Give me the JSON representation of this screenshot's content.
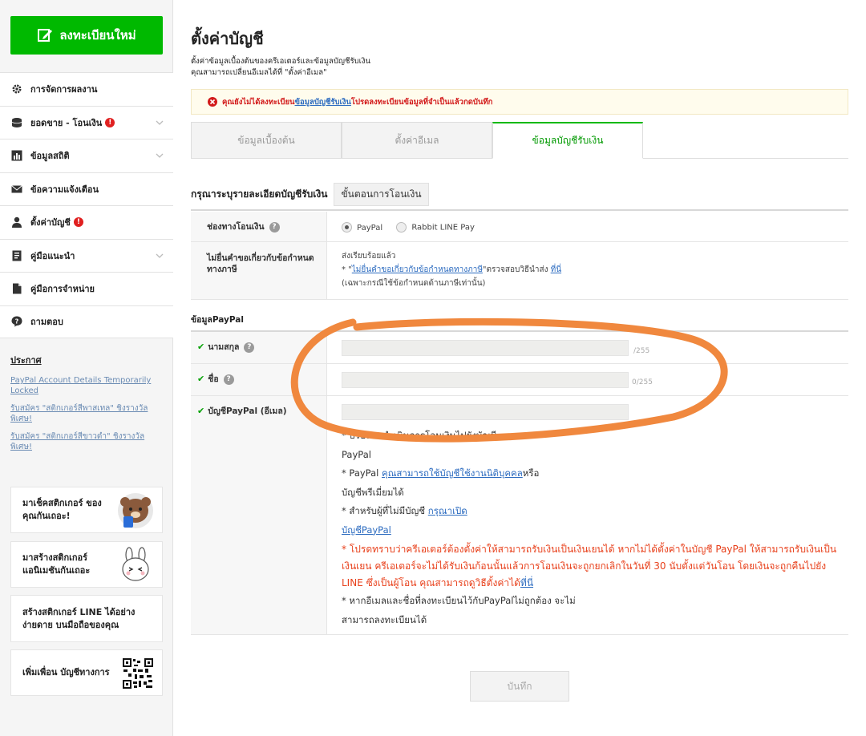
{
  "sidebar": {
    "register_label": "ลงทะเบียนใหม่",
    "items": [
      {
        "label": "การจัดการผลงาน",
        "icon": "gear-icon",
        "alert": false,
        "chevron": false
      },
      {
        "label": "ยอดขาย - โอนเงิน",
        "icon": "coins-icon",
        "alert": true,
        "chevron": true
      },
      {
        "label": "ข้อมูลสถิติ",
        "icon": "bar-chart-icon",
        "alert": false,
        "chevron": true
      },
      {
        "label": "ข้อความแจ้งเตือน",
        "icon": "mail-icon",
        "alert": false,
        "chevron": false
      },
      {
        "label": "ตั้งค่าบัญชี",
        "icon": "user-icon",
        "alert": true,
        "chevron": false
      },
      {
        "label": "คู่มือแนะนำ",
        "icon": "book-icon",
        "alert": false,
        "chevron": true
      },
      {
        "label": "คู่มือการจำหน่าย",
        "icon": "document-icon",
        "alert": false,
        "chevron": false
      },
      {
        "label": "ถามตอบ",
        "icon": "question-icon",
        "alert": false,
        "chevron": false
      }
    ],
    "alert_mark": "!",
    "notice": {
      "title": "ประกาศ",
      "links": [
        "PayPal Account Details Temporarily Locked",
        "รับสมัคร \"สติกเกอร์สีพาสเทล\" ชิงรางวัลพิเศษ!",
        "รับสมัคร \"สติกเกอร์สีขาวดำ\" ชิงรางวัลพิเศษ!"
      ]
    },
    "promos": [
      {
        "text": "มาเช็คสติกเกอร์ ของคุณกันเถอะ!"
      },
      {
        "text": "มาสร้างสติกเกอร์ แอนิเมชันกันเถอะ"
      },
      {
        "text": "สร้างสติกเกอร์ LINE ได้อย่างง่ายดาย บนมือถือของคุณ"
      },
      {
        "text": "เพิ่มเพื่อน บัญชีทางการ"
      }
    ]
  },
  "main": {
    "title": "ตั้งค่าบัญชี",
    "desc_line1": "ตั้งค่าข้อมูลเบื้องต้นของครีเอเตอร์และข้อมูลบัญชีรับเงิน",
    "desc_line2": "คุณสามารถเปลี่ยนอีเมลได้ที่ \"ตั้งค่าอีเมล\"",
    "warning": {
      "before": "คุณยังไม่ได้ลงทะเบียน",
      "link": "ข้อมูลบัญชีรับเงิน",
      "after": " โปรดลงทะเบียนข้อมูลที่จำเป็นแล้วกดบันทึก"
    },
    "tabs": [
      "ข้อมูลเบื้องต้น",
      "ตั้งค่าอีเมล",
      "ข้อมูลบัญชีรับเงิน"
    ],
    "section_title": "กรุณาระบุรายละเอียดบัญชีรับเงิน",
    "procedure_button": "ขั้นตอนการโอนเงิน",
    "transfer_label": "ช่องทางโอนเงิน",
    "radio_paypal": "PayPal",
    "radio_rabbit": "Rabbit LINE Pay",
    "tax_label": "ไม่ยื่นคำขอเกี่ยวกับข้อกำหนดทางภาษี",
    "tax_line1": "ส่งเรียบร้อยแล้ว",
    "tax_line2_prefix": "* \"",
    "tax_line2_link": "ไม่ยื่นคำขอเกี่ยวกับข้อกำหนดทางภาษี",
    "tax_line2_mid": "\"ตรวจสอบวิธีนำส่ง ",
    "tax_line2_link2": "ที่นี่",
    "tax_line3": "(เฉพาะกรณีใช้ข้อกำหนดด้านภาษีเท่านั้น)",
    "help_mark": "?",
    "paypal_head": "ข้อมูลPayPal",
    "lastname_label": "นามสกุล",
    "firstname_label": "ชื่อ",
    "email_label": "บัญชีPayPal (อีเมล)",
    "counter_lastname": "/255",
    "counter_firstname": "0/255",
    "notes": {
      "n1a": "* บริษัทจะดำเนินการโอนเงินไปยังบัญชี",
      "n1b": "PayPal",
      "n2a": "* PayPal ",
      "n2link": "คุณสามารถใช้บัญชีใช้งานนิติบุคคล",
      "n2b": "หรือ",
      "n2c": "บัญชีพรีเมี่ยมได้",
      "n3a": "* สำหรับผู้ที่ไม่มีบัญชี ",
      "n3link": "กรุณาเปิด",
      "n3link2": "บัญชีPayPal",
      "red": "* โปรดทราบว่าครีเอเตอร์ต้องตั้งค่าให้สามารถรับเงินเป็นเงินเยนได้ หากไม่ได้ตั้งค่าในบัญชี PayPal ให้สามารถรับเงินเป็นเงินเยน ครีเอเตอร์จะไม่ได้รับเงินก้อนนั้นแล้วการโอนเงินจะถูกยกเลิกในวันที่ 30 นับตั้งแต่วันโอน โดยเงินจะถูกคืนไปยัง LINE ซึ่งเป็นผู้โอน คุณสามารถดูวิธีตั้งค่าได้",
      "redlink": "ที่นี่",
      "n4a": "* หากอีเมลและชื่อที่ลงทะเบียนไว้กับPayPalไม่ถูกต้อง จะไม่",
      "n4b": "สามารถลงทะเบียนได้"
    },
    "save_label": "บันทึก"
  },
  "colors": {
    "brand": "#00b900",
    "annotation": "#f0883e",
    "alert": "#d21a1a"
  }
}
